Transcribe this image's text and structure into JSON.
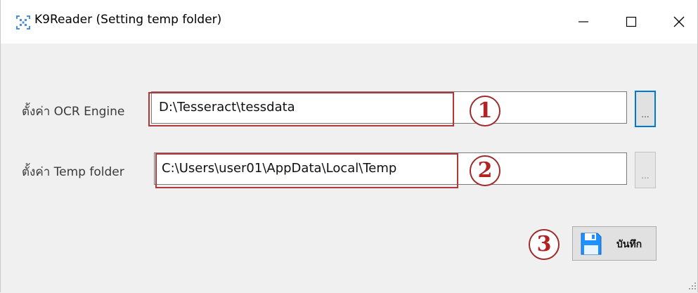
{
  "window": {
    "title": "K9Reader (Setting temp folder)"
  },
  "form": {
    "ocr": {
      "label": "ตั้งค่า OCR Engine",
      "value": "D:\\Tesseract\\tessdata",
      "browse_label": "...",
      "marker": "1"
    },
    "temp": {
      "label": "ตั้งค่า Temp folder",
      "value": "C:\\Users\\user01\\AppData\\Local\\Temp",
      "browse_label": "...",
      "marker": "2"
    },
    "save": {
      "label": "บันทึก",
      "marker": "3"
    }
  },
  "colors": {
    "annotation_red": "#b3363a",
    "focus_blue": "#0078d7",
    "save_icon_blue": "#1e90ff"
  }
}
